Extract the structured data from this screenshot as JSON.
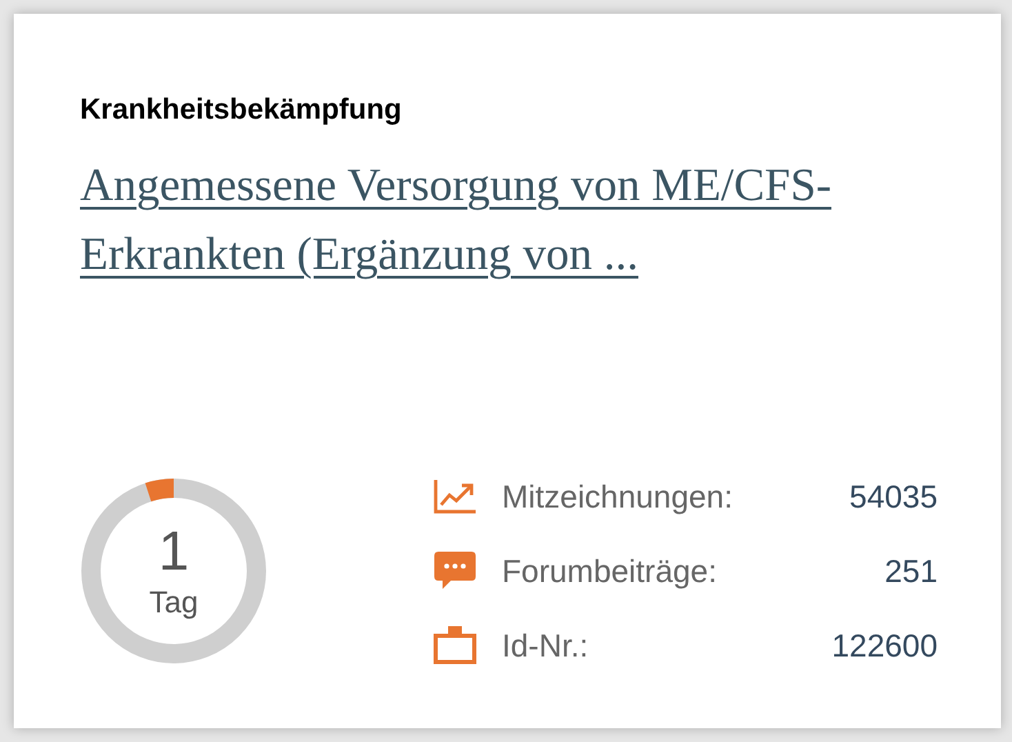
{
  "category": "Krankheitsbekämpfung",
  "title_link": "Angemessene Versorgung von ME/CFS-Erkrankten (Ergänzung von ...",
  "countdown": {
    "value": "1",
    "unit": "Tag",
    "level": 0.05
  },
  "stats": [
    {
      "kind": "signatures",
      "label": "Mitzeichnungen:",
      "value": "54035"
    },
    {
      "kind": "forum",
      "label": "Forumbeiträge:",
      "value": "251"
    },
    {
      "kind": "id",
      "label": "Id-Nr.:",
      "value": "122600"
    }
  ]
}
